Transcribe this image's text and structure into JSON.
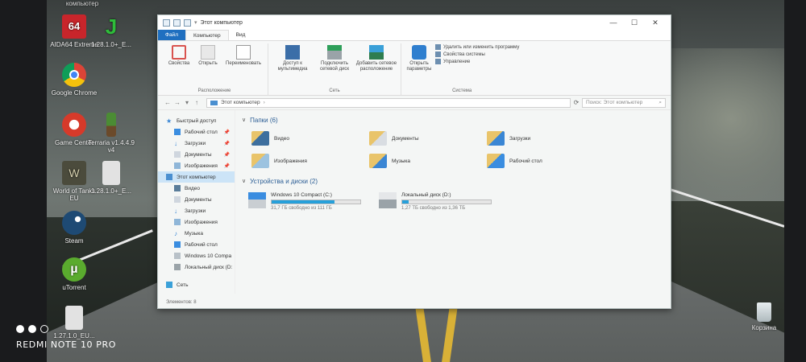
{
  "desktop": {
    "top_label": "компьютер",
    "icons": [
      {
        "label": "AIDA64 Extreme",
        "icon": "aida64-icon",
        "color": "#c8252b"
      },
      {
        "label": "1.28.1.0+_E...",
        "icon": "java-icon",
        "color": "#2ebd3a"
      },
      {
        "label": "Google Chrome",
        "icon": "chrome-icon",
        "color": "#e0432f"
      },
      {
        "label": "Game Center",
        "icon": "game-center-icon",
        "color": "#d63a2a"
      },
      {
        "label": "Terraria v1.4.4.9 v4",
        "icon": "terraria-icon",
        "color": "#4b8c34"
      },
      {
        "label": "World of Tanks EU",
        "icon": "world-of-tanks-icon",
        "color": "#4b4b3c"
      },
      {
        "label": "1.28.1.0+_E...",
        "icon": "file-icon",
        "color": "#d9d9d9"
      },
      {
        "label": "Steam",
        "icon": "steam-icon",
        "color": "#1e4a74"
      },
      {
        "label": "uTorrent",
        "icon": "utorrent-icon",
        "color": "#5aab2e"
      },
      {
        "label": "1.27.1.0_EU...",
        "icon": "file-icon",
        "color": "#d9d9d9"
      },
      {
        "label": "Корзина",
        "icon": "recycle-bin-icon",
        "color": "#cfd8dc"
      }
    ]
  },
  "window": {
    "title": "Этот компьютер",
    "tabs": {
      "file": "Файл",
      "computer": "Компьютер",
      "view": "Вид"
    },
    "ribbon": {
      "group_location": "Расположение",
      "group_network": "Сеть",
      "group_system": "Система",
      "properties": "Свойства",
      "open": "Открыть",
      "rename": "Переименовать",
      "media_access": "Доступ к мультимедиа",
      "map_drive": "Подключить сетевой диск",
      "add_location": "Добавить сетевое расположение",
      "open_settings": "Открыть параметры",
      "uninstall": "Удалить или изменить программу",
      "system_props": "Свойства системы",
      "manage": "Управление"
    },
    "address": {
      "path": "Этот компьютер",
      "search_placeholder": "Поиск: Этот компьютер"
    },
    "nav": {
      "quick_access": "Быстрый доступ",
      "desktop": "Рабочий стол",
      "downloads": "Загрузки",
      "documents": "Документы",
      "pictures": "Изображения",
      "this_pc": "Этот компьютер",
      "video": "Видео",
      "pc_documents": "Документы",
      "pc_downloads": "Загрузки",
      "pc_pictures": "Изображения",
      "music": "Музыка",
      "pc_desktop": "Рабочий стол",
      "drive_c": "Windows 10 Compa",
      "drive_d": "Локальный диск (D:",
      "network": "Сеть"
    },
    "folders_header": "Папки (6)",
    "folders": [
      "Видео",
      "Документы",
      "Загрузки",
      "Изображения",
      "Музыка",
      "Рабочий стол"
    ],
    "devices_header": "Устройства и диски (2)",
    "drives": [
      {
        "name": "Windows 10 Compact (C:)",
        "free": "31,7 ГБ свободно из 111 ГБ",
        "used_fraction": 0.71
      },
      {
        "name": "Локальный диск (D:)",
        "free": "1,27 ТБ свободно из 1,36 ТБ",
        "used_fraction": 0.07
      }
    ],
    "status": "Элементов: 8"
  },
  "watermark": {
    "model": "REDMI NOTE 10 PRO"
  }
}
